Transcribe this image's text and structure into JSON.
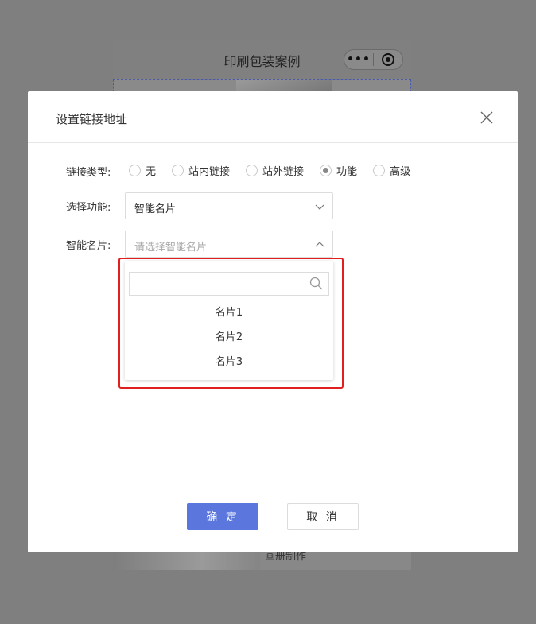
{
  "background": {
    "phone_title": "印刷包装案例",
    "capsule_menu": "•••",
    "bottom_text": "画册制作"
  },
  "modal": {
    "title": "设置链接地址",
    "link_type": {
      "label": "链接类型:",
      "options": [
        "无",
        "站内链接",
        "站外链接",
        "功能",
        "高级"
      ],
      "selected": "功能"
    },
    "function": {
      "label": "选择功能:",
      "value": "智能名片"
    },
    "card": {
      "label": "智能名片:",
      "placeholder": "请选择智能名片",
      "search_value": "",
      "options": [
        "名片1",
        "名片2",
        "名片3"
      ]
    },
    "ok_label": "确 定",
    "cancel_label": "取 消"
  },
  "colors": {
    "primary": "#5b77dd",
    "highlight": "#e02020",
    "overlay": "#7f7f7f"
  }
}
